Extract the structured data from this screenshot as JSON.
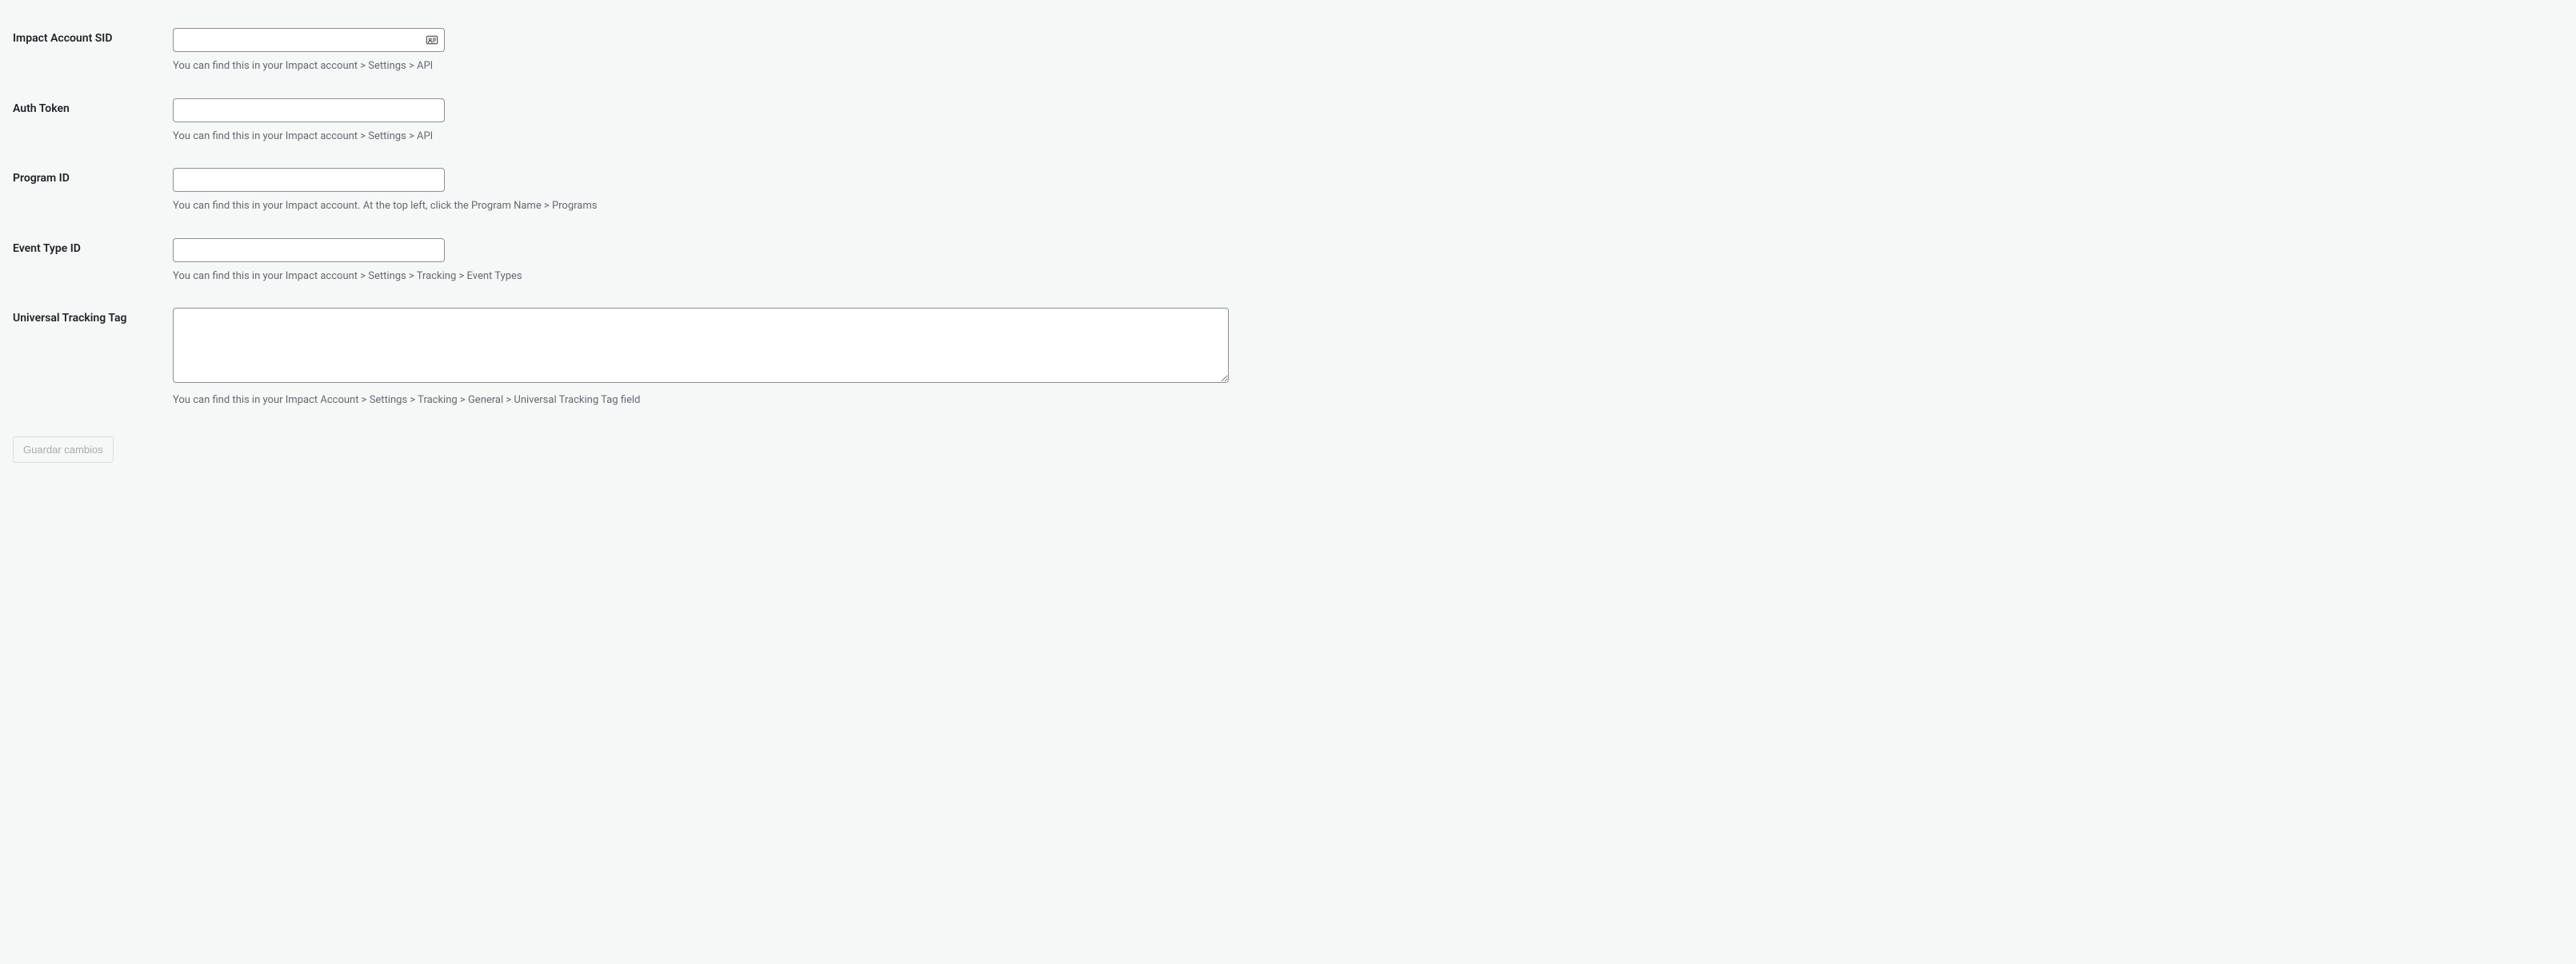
{
  "fields": {
    "account_sid": {
      "label": "Impact Account SID",
      "value": "",
      "description": "You can find this in your Impact account > Settings > API"
    },
    "auth_token": {
      "label": "Auth Token",
      "value": "",
      "description": "You can find this in your Impact account > Settings > API"
    },
    "program_id": {
      "label": "Program ID",
      "value": "",
      "description": "You can find this in your Impact account. At the top left, click the Program Name > Programs"
    },
    "event_type_id": {
      "label": "Event Type ID",
      "value": "",
      "description": "You can find this in your Impact account > Settings > Tracking > Event Types"
    },
    "universal_tracking_tag": {
      "label": "Universal Tracking Tag",
      "value": "",
      "description": "You can find this in your Impact Account > Settings > Tracking > General > Universal Tracking Tag field"
    }
  },
  "submit": {
    "label": "Guardar cambios"
  }
}
